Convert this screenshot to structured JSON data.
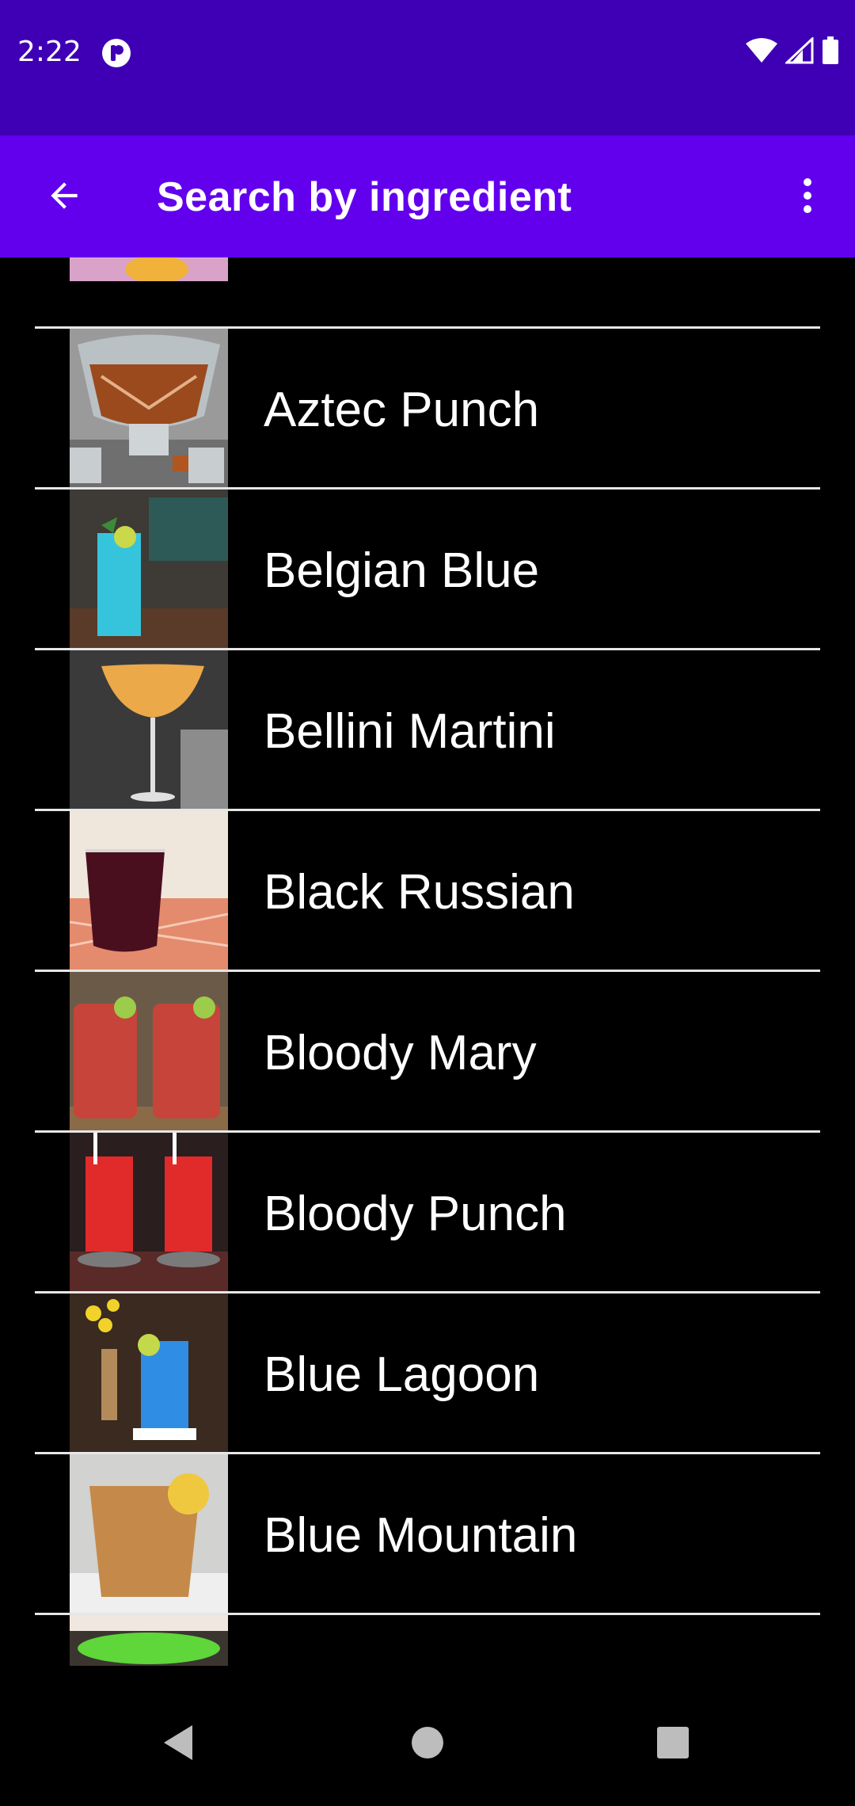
{
  "status_bar": {
    "time": "2:22",
    "icons": [
      "app-notification-icon",
      "wifi-icon",
      "cell-signal-icon",
      "battery-icon"
    ]
  },
  "app_bar": {
    "title": "Search by ingredient",
    "back_icon": "arrow-back-icon",
    "menu_icon": "more-vert-icon"
  },
  "drinks": [
    {
      "name": "",
      "thumb": "partial-top-drink"
    },
    {
      "name": "Aztec Punch",
      "thumb": "punch-bowl"
    },
    {
      "name": "Belgian Blue",
      "thumb": "blue-drink"
    },
    {
      "name": "Bellini Martini",
      "thumb": "coupe-glass"
    },
    {
      "name": "Black Russian",
      "thumb": "dark-rocks-glass"
    },
    {
      "name": "Bloody Mary",
      "thumb": "red-mason-jars"
    },
    {
      "name": "Bloody Punch",
      "thumb": "red-highballs"
    },
    {
      "name": "Blue Lagoon",
      "thumb": "blue-highball"
    },
    {
      "name": "Blue Mountain",
      "thumb": "amber-rocks-glass"
    },
    {
      "name": "",
      "thumb": "partial-bottom-green"
    }
  ],
  "colors": {
    "status_bar": "#3F00B5",
    "app_bar": "#6200EE",
    "background": "#000000",
    "divider": "#e6e6e6",
    "text": "#ffffff"
  },
  "nav_bar": {
    "buttons": [
      "nav-back-icon",
      "nav-home-icon",
      "nav-recents-icon"
    ]
  }
}
